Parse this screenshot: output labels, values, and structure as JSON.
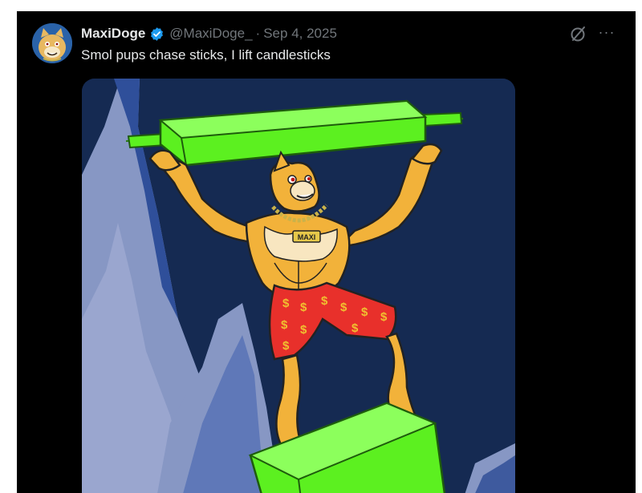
{
  "tweet": {
    "author_name": "MaxiDoge",
    "handle": "@MaxiDoge_",
    "separator": "·",
    "date": "Sep 4, 2025",
    "text": "Smol pups chase sticks, I lift candlesticks",
    "verified": true,
    "more_label": "···"
  },
  "media": {
    "necklace_tag": "MAXI",
    "shorts_pattern": "$"
  },
  "icons": {
    "verified": "verified-badge-icon",
    "grok": "grok-icon",
    "more": "more-icon"
  },
  "colors": {
    "background": "#000000",
    "text_primary": "#e7e9ea",
    "text_secondary": "#71767b",
    "verified_blue": "#1d9bf0",
    "candle_green": "#5cf020",
    "shorts_red": "#e8302b",
    "sky": "#152a52"
  }
}
